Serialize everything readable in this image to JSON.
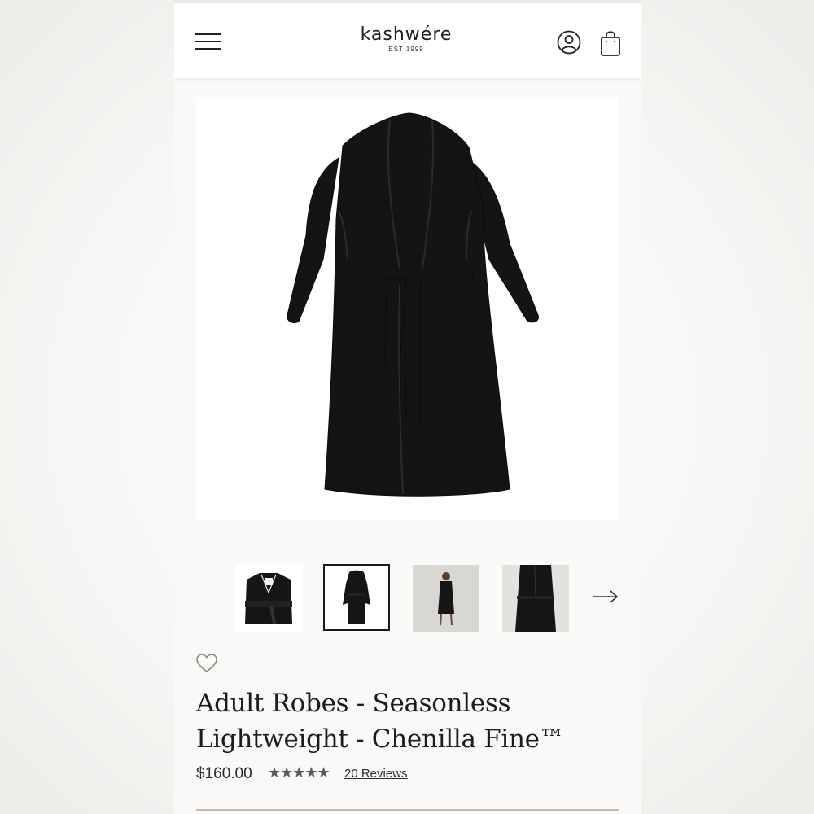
{
  "header": {
    "brand": "kashwére",
    "brand_sub": "EST 1999",
    "menu_icon": "hamburger-menu-icon",
    "account_icon": "user-account-icon",
    "bag_icon": "shopping-bag-icon"
  },
  "gallery": {
    "thumbnails": [
      {
        "name": "folded robe",
        "selected": false
      },
      {
        "name": "robe flat lay",
        "selected": true
      },
      {
        "name": "model wearing robe full length",
        "selected": false
      },
      {
        "name": "model wearing robe close up",
        "selected": false
      }
    ],
    "next_icon": "arrow-right-icon"
  },
  "product": {
    "wishlist_icon": "heart-icon",
    "title_line1": "Adult Robes - Seasonless",
    "title_line2": "Lightweight - Chenilla Fine™",
    "price": "$160.00",
    "rating": 5,
    "stars": "★★★★★",
    "reviews_label": "20 Reviews"
  },
  "colors": {
    "accent_rule": "#c9b9a8",
    "star": "#5a5a5a",
    "robe": "#141414"
  }
}
